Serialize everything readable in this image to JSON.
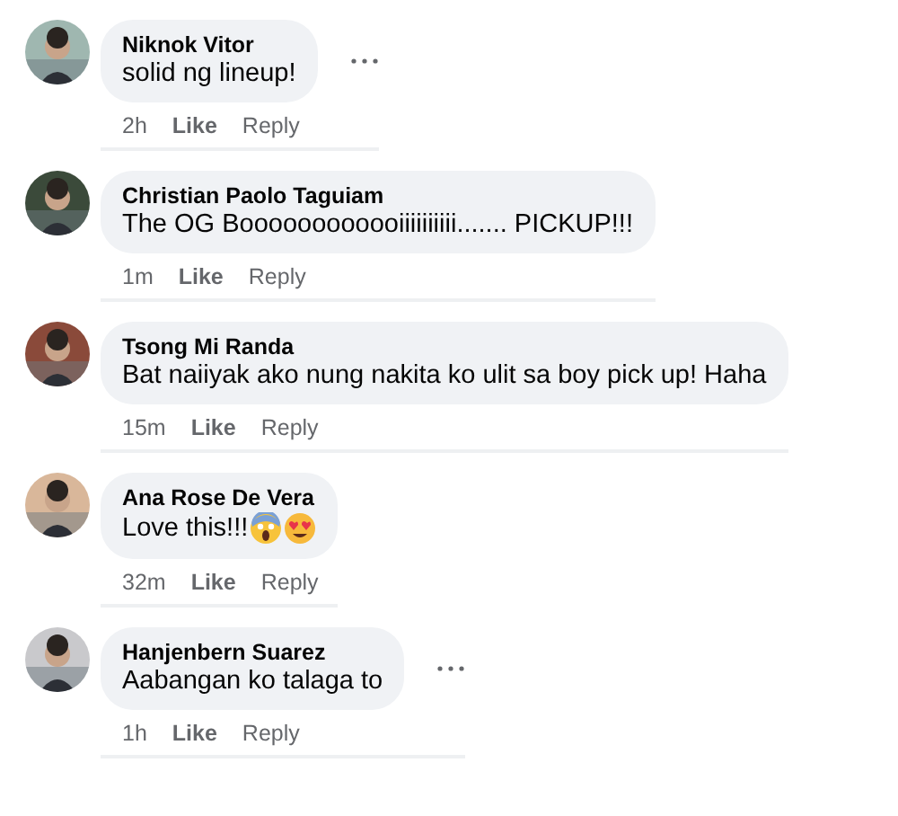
{
  "comments": [
    {
      "author": "Niknok Vitor",
      "text": "solid ng lineup!",
      "time": "2h",
      "like": "Like",
      "reply": "Reply",
      "options": true
    },
    {
      "author": "Christian Paolo Taguiam",
      "text": "The OG Boooooooooooiiiiiiiiii....... PICKUP!!!",
      "time": "1m",
      "like": "Like",
      "reply": "Reply",
      "options": false
    },
    {
      "author": "Tsong Mi Randa",
      "text": "Bat naiiyak ako nung nakita ko ulit sa boy pick up! Haha",
      "time": "15m",
      "like": "Like",
      "reply": "Reply",
      "options": false
    },
    {
      "author": "Ana Rose De Vera",
      "text": "Love this!!!",
      "emojis": [
        {
          "kind": "scream"
        },
        {
          "kind": "heart-eyes"
        }
      ],
      "time": "32m",
      "like": "Like",
      "reply": "Reply",
      "options": false
    },
    {
      "author": "Hanjenbern Suarez",
      "text": "Aabangan ko talaga to",
      "time": "1h",
      "like": "Like",
      "reply": "Reply",
      "options": true
    }
  ]
}
